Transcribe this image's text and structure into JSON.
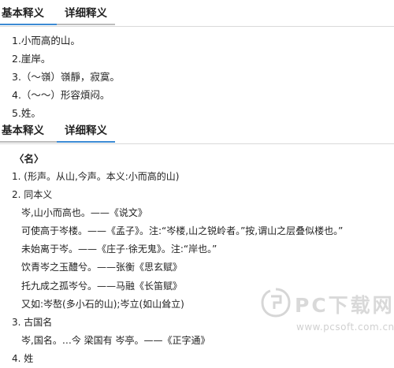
{
  "tabs_top": {
    "basic": "基本释义",
    "detail": "详细释义"
  },
  "brief": [
    "1.小而高的山。",
    "2.崖岸。",
    "3.（～嶺）嶺靜，寂寞。",
    "4.（～～）形容煩闷。",
    "5.姓。"
  ],
  "tabs_mid": {
    "basic": "基本释义",
    "detail": "详细释义"
  },
  "detail": {
    "heading": "〈名〉",
    "lines": [
      {
        "level": 0,
        "text": "1. (形声。从山,今声。本义:小而高的山)"
      },
      {
        "level": 0,
        "text": "2. 同本义"
      },
      {
        "level": 1,
        "text": "岑,山小而高也。——《说文》"
      },
      {
        "level": 1,
        "text": "可使高于岑楼。——《孟子》。注:“岑楼,山之锐岭者。”按,谓山之层叠似楼也。”"
      },
      {
        "level": 1,
        "text": "未始离于岑。——《庄子·徐无鬼》。注:“岸也。”"
      },
      {
        "level": 1,
        "text": "饮青岑之玉醴兮。——张衡《思玄赋》"
      },
      {
        "level": 1,
        "text": "托九成之孤岑兮。——马融《长笛赋》"
      },
      {
        "level": 1,
        "text": "又如:岑嶅(多小石的山);岑立(如山耸立)"
      },
      {
        "level": 0,
        "text": "3. 古国名"
      },
      {
        "level": 1,
        "text": "岑,国名。…今 梁国有 岑亭。——《正字通》"
      },
      {
        "level": 0,
        "text": "4. 姓"
      }
    ]
  },
  "watermark": {
    "text": "PC下载网",
    "url": "www.pcsoft.com.cn",
    "logo_icon": "pcsoft-logo-icon"
  }
}
